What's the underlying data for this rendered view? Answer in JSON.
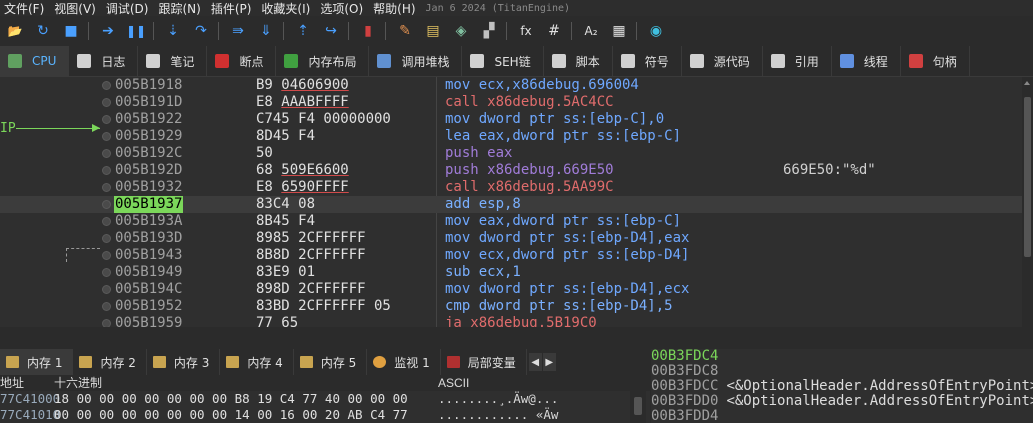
{
  "menu": [
    "文件(F)",
    "视图(V)",
    "调试(D)",
    "跟踪(N)",
    "插件(P)",
    "收藏夹(I)",
    "选项(O)",
    "帮助(H)"
  ],
  "build_date": "Jan 6 2024 (TitanEngine)",
  "toolbar": [
    {
      "icon": "open-icon",
      "glyph": "📂",
      "color": "#e0b040"
    },
    {
      "icon": "restart-icon",
      "glyph": "↻",
      "color": "#4aa0ff"
    },
    {
      "icon": "stop-icon",
      "glyph": "■",
      "color": "#4aa0ff"
    },
    {
      "icon": "run-icon",
      "glyph": "➔",
      "color": "#4aa0ff"
    },
    {
      "icon": "pause-icon",
      "glyph": "❚❚",
      "color": "#4aa0ff"
    },
    {
      "icon": "step-into-icon",
      "glyph": "⇣",
      "color": "#4aa0ff"
    },
    {
      "icon": "step-over-icon",
      "glyph": "↷",
      "color": "#4aa0ff"
    },
    {
      "icon": "trace-into-icon",
      "glyph": "⇛",
      "color": "#4aa0ff"
    },
    {
      "icon": "trace-over-icon",
      "glyph": "⇓",
      "color": "#4aa0ff"
    },
    {
      "icon": "execute-till-return-icon",
      "glyph": "⇡",
      "color": "#4aa0ff"
    },
    {
      "icon": "run-to-user-code-icon",
      "glyph": "↪",
      "color": "#4aa0ff"
    },
    {
      "icon": "scylla-icon",
      "glyph": "▮",
      "color": "#d04040"
    },
    {
      "icon": "patch-icon",
      "glyph": "✎",
      "color": "#e09050"
    },
    {
      "icon": "comments-icon",
      "glyph": "▤",
      "color": "#e0c060"
    },
    {
      "icon": "labels-icon",
      "glyph": "◈",
      "color": "#80c0a0"
    },
    {
      "icon": "bookmarks-icon",
      "glyph": "▞",
      "color": "#c0c0c0"
    },
    {
      "icon": "function-icon",
      "glyph": "fx",
      "color": "#e0e0e0"
    },
    {
      "icon": "hash-icon",
      "glyph": "#",
      "color": "#e0e0e0"
    },
    {
      "icon": "font-icon",
      "glyph": "A₂",
      "color": "#e0e0e0"
    },
    {
      "icon": "calculator-icon",
      "glyph": "▦",
      "color": "#e0e0e0"
    },
    {
      "icon": "globe-icon",
      "glyph": "◉",
      "color": "#40c0e0"
    }
  ],
  "tabs": [
    {
      "label": "CPU",
      "icon": "cpu-icon",
      "color": "#60a060",
      "active": true
    },
    {
      "label": "日志",
      "icon": "log-icon",
      "color": "#d0d0d0"
    },
    {
      "label": "笔记",
      "icon": "notes-icon",
      "color": "#d0d0d0"
    },
    {
      "label": "断点",
      "icon": "breakpoint-icon",
      "color": "#d03030"
    },
    {
      "label": "内存布局",
      "icon": "memory-map-icon",
      "color": "#40a040"
    },
    {
      "label": "调用堆栈",
      "icon": "call-stack-icon",
      "color": "#6090d0"
    },
    {
      "label": "SEH链",
      "icon": "seh-icon",
      "color": "#d0d0d0"
    },
    {
      "label": "脚本",
      "icon": "script-icon",
      "color": "#d0d0d0"
    },
    {
      "label": "符号",
      "icon": "symbols-icon",
      "color": "#d0d0d0"
    },
    {
      "label": "源代码",
      "icon": "source-icon",
      "color": "#d0d0d0"
    },
    {
      "label": "引用",
      "icon": "references-icon",
      "color": "#d0d0d0"
    },
    {
      "label": "线程",
      "icon": "threads-icon",
      "color": "#6090e0"
    },
    {
      "label": "句柄",
      "icon": "handles-icon",
      "color": "#d04040"
    }
  ],
  "disasm": [
    {
      "addr": "005B1918",
      "bytes": [
        "B9 ",
        "04606900",
        ""
      ],
      "ins": "mov ecx,x86debug.696004",
      "cls": "mov",
      "cmt": ""
    },
    {
      "addr": "005B191D",
      "bytes": [
        "E8 ",
        "AAABFFFF",
        ""
      ],
      "ins": "call x86debug.5AC4CC",
      "cls": "call",
      "cmt": ""
    },
    {
      "addr": "005B1922",
      "bytes": [
        "C745 F4 00000000",
        "",
        ""
      ],
      "ins": "mov dword ptr ss:[ebp-C],0",
      "cls": "mov",
      "cmt": ""
    },
    {
      "addr": "005B1929",
      "bytes": [
        "8D45 F4",
        "",
        ""
      ],
      "ins": "lea eax,dword ptr ss:[ebp-C]",
      "cls": "lea",
      "cmt": ""
    },
    {
      "addr": "005B192C",
      "bytes": [
        "50",
        "",
        ""
      ],
      "ins": "push eax",
      "cls": "push",
      "cmt": ""
    },
    {
      "addr": "005B192D",
      "bytes": [
        "68 ",
        "509E6600",
        ""
      ],
      "ins": "push x86debug.669E50",
      "cls": "pushx",
      "cmt": "669E50:\"%d\""
    },
    {
      "addr": "005B1932",
      "bytes": [
        "E8 ",
        "6590FFFF",
        ""
      ],
      "ins": "call x86debug.5AA99C",
      "cls": "call",
      "cmt": ""
    },
    {
      "addr": "005B1937",
      "bytes": [
        "83C4 08",
        "",
        ""
      ],
      "ins": "add esp,8",
      "cls": "add",
      "cmt": "",
      "current": true
    },
    {
      "addr": "005B193A",
      "bytes": [
        "8B45 F4",
        "",
        ""
      ],
      "ins": "mov eax,dword ptr ss:[ebp-C]",
      "cls": "mov",
      "cmt": ""
    },
    {
      "addr": "005B193D",
      "bytes": [
        "8985 2CFFFFFF",
        "",
        ""
      ],
      "ins": "mov dword ptr ss:[ebp-D4],eax",
      "cls": "mov",
      "cmt": ""
    },
    {
      "addr": "005B1943",
      "bytes": [
        "8B8D 2CFFFFFF",
        "",
        ""
      ],
      "ins": "mov ecx,dword ptr ss:[ebp-D4]",
      "cls": "mov",
      "cmt": ""
    },
    {
      "addr": "005B1949",
      "bytes": [
        "83E9 01",
        "",
        ""
      ],
      "ins": "sub ecx,1",
      "cls": "sub",
      "cmt": ""
    },
    {
      "addr": "005B194C",
      "bytes": [
        "898D 2CFFFFFF",
        "",
        ""
      ],
      "ins": "mov dword ptr ss:[ebp-D4],ecx",
      "cls": "mov",
      "cmt": ""
    },
    {
      "addr": "005B1952",
      "bytes": [
        "83BD 2CFFFFFF 05",
        "",
        ""
      ],
      "ins": "cmp dword ptr ss:[ebp-D4],5",
      "cls": "cmp",
      "cmt": ""
    },
    {
      "addr": "005B1959",
      "bytes": [
        "77 65",
        "",
        ""
      ],
      "ins": "ja x86debug.5B19C0",
      "cls": "jmp",
      "cmt": ""
    }
  ],
  "ip_label": "IP",
  "bottom_tabs": [
    {
      "label": "内存 1",
      "icon": "memory-1-icon",
      "active": true
    },
    {
      "label": "内存 2",
      "icon": "memory-2-icon"
    },
    {
      "label": "内存 3",
      "icon": "memory-3-icon"
    },
    {
      "label": "内存 4",
      "icon": "memory-4-icon"
    },
    {
      "label": "内存 5",
      "icon": "memory-5-icon"
    },
    {
      "label": "监视 1",
      "icon": "watch-icon",
      "cat": true
    },
    {
      "label": "局部变量",
      "icon": "locals-icon",
      "red": true
    }
  ],
  "dump": {
    "headers": {
      "addr": "地址",
      "hex": "十六进制",
      "ascii": "ASCII"
    },
    "rows": [
      {
        "addr": "77C41000",
        "hex": "18 00 00 00  00 00 00 00  B8 19 C4 77  40 00 00 00",
        "ascii": "........¸.Äw@..."
      },
      {
        "addr": "77C41010",
        "hex": "00 00 00 00  00 00 00 00  14 00 16 00  20 AB C4 77",
        "ascii": "............ «Äw"
      }
    ]
  },
  "stack": [
    {
      "addr": "00B3FDC4",
      "val": "",
      "cur": true
    },
    {
      "addr": "00B3FDC8",
      "val": ""
    },
    {
      "addr": "00B3FDCC",
      "val": "<&OptionalHeader.AddressOfEntryPoint>"
    },
    {
      "addr": "00B3FDD0",
      "val": "<&OptionalHeader.AddressOfEntryPoint>"
    },
    {
      "addr": "00B3FDD4",
      "val": ""
    }
  ]
}
